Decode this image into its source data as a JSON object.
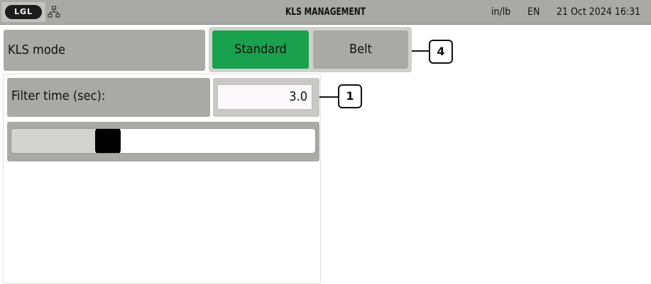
{
  "header": {
    "logo_text": "LGL",
    "title": "KLS MANAGEMENT",
    "units": "in/lb",
    "language": "EN",
    "datetime": "21 Oct 2024 16:31"
  },
  "kls_mode": {
    "label": "KLS mode",
    "options": [
      "Standard",
      "Belt"
    ],
    "selected": "Standard",
    "selected_color": "#1aa14d"
  },
  "filter": {
    "label": "Filter time (sec):",
    "value": "3.0",
    "slider_level": 0.3
  },
  "callouts": {
    "mode_callout": "4",
    "filter_callout": "1"
  },
  "colors": {
    "bar": "#a9a9a5",
    "accent": "#1aa14d"
  }
}
